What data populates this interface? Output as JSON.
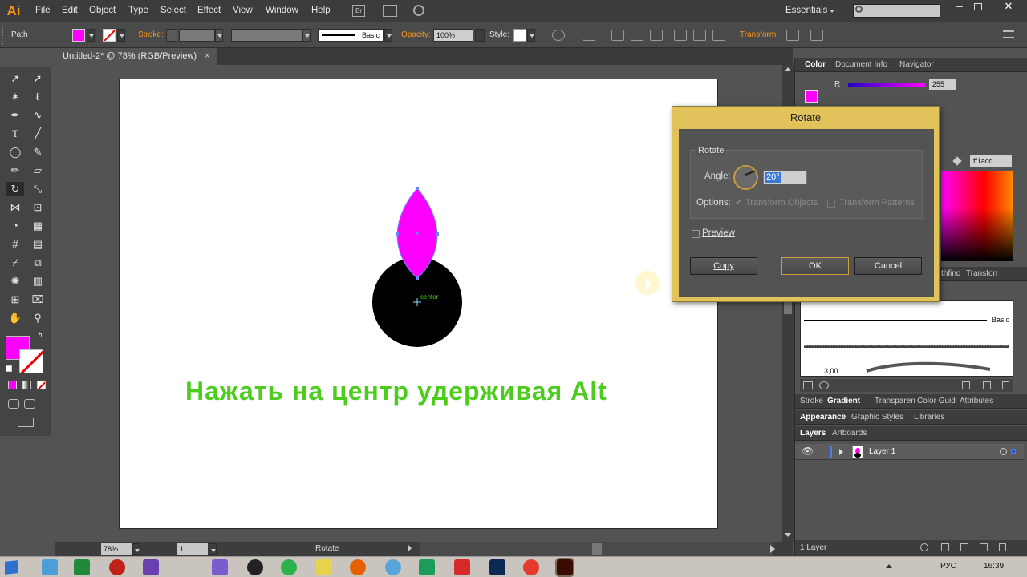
{
  "app": {
    "logo": "Ai",
    "workspace": "Essentials"
  },
  "menu": [
    "File",
    "Edit",
    "Object",
    "Type",
    "Select",
    "Effect",
    "View",
    "Window",
    "Help"
  ],
  "control": {
    "selection": "Path",
    "stroke_label": "Stroke:",
    "brush": "Basic",
    "opacity_label": "Opacity:",
    "opacity_value": "100%",
    "style_label": "Style:",
    "transform_label": "Transform"
  },
  "document": {
    "tab_title": "Untitled-2* @ 78% (RGB/Preview)"
  },
  "canvas": {
    "center_label": "center",
    "instruction": "Нажать на центр удерживая Alt",
    "colors": {
      "fill": "#ff00ff",
      "circle": "#000000",
      "instruction": "#4ccc1c"
    }
  },
  "status": {
    "zoom": "78%",
    "artboard": "1",
    "tool": "Rotate"
  },
  "panels": {
    "color_tabs": [
      "Color",
      "Document Info",
      "Navigator"
    ],
    "r_label": "R",
    "r_value": "255",
    "hex_value": "ff1acd",
    "mid_tabs": [
      "thfind",
      "Transfon"
    ],
    "brush_label": "Basic",
    "brush_size": "3,00",
    "stroke_tabs": [
      "Stroke",
      "Gradient",
      "Transparen",
      "Color Guid",
      "Attributes"
    ],
    "appearance_tabs": [
      "Appearance",
      "Graphic Styles",
      "Libraries"
    ],
    "layers_tabs": [
      "Layers",
      "Artboards"
    ],
    "layer_name": "Layer 1",
    "layers_count": "1 Layer"
  },
  "dialog": {
    "title": "Rotate",
    "section": "Rotate",
    "angle_label": "Angle:",
    "angle_value": "20°",
    "options_label": "Options:",
    "transform_objects": "Transform Objects",
    "transform_patterns": "Transform Patterns",
    "preview": "Preview",
    "copy": "Copy",
    "ok": "OK",
    "cancel": "Cancel"
  },
  "taskbar": {
    "lang": "РУС",
    "time": "16:39"
  }
}
